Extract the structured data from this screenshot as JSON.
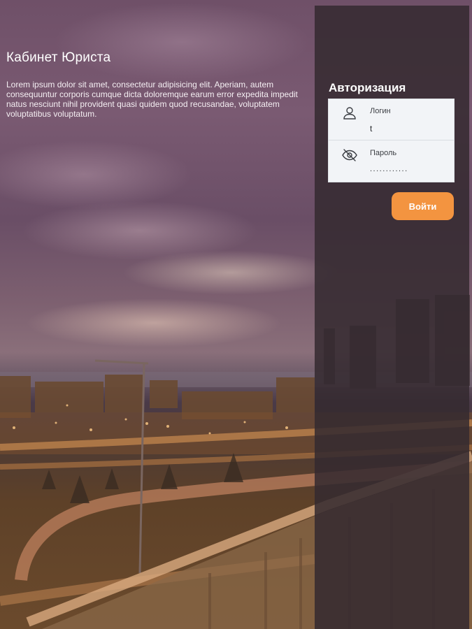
{
  "intro": {
    "title": "Кабинет Юриста",
    "text": "Lorem ipsum dolor sit amet, consectetur adipisicing elit. Aperiam, autem consequuntur corporis cumque dicta doloremque earum error expedita impedit natus nesciunt nihil provident quasi quidem quod recusandae, voluptatem voluptatibus voluptatum."
  },
  "auth": {
    "title": "Авторизация",
    "login": {
      "label": "Логин",
      "value": "t",
      "icon": "user-icon"
    },
    "password": {
      "label": "Пароль",
      "value": "............",
      "icon": "eye-off-icon"
    },
    "submit_label": "Войти"
  },
  "colors": {
    "accent": "#f39440",
    "panel": "#342a30",
    "card": "#f2f4f7"
  }
}
